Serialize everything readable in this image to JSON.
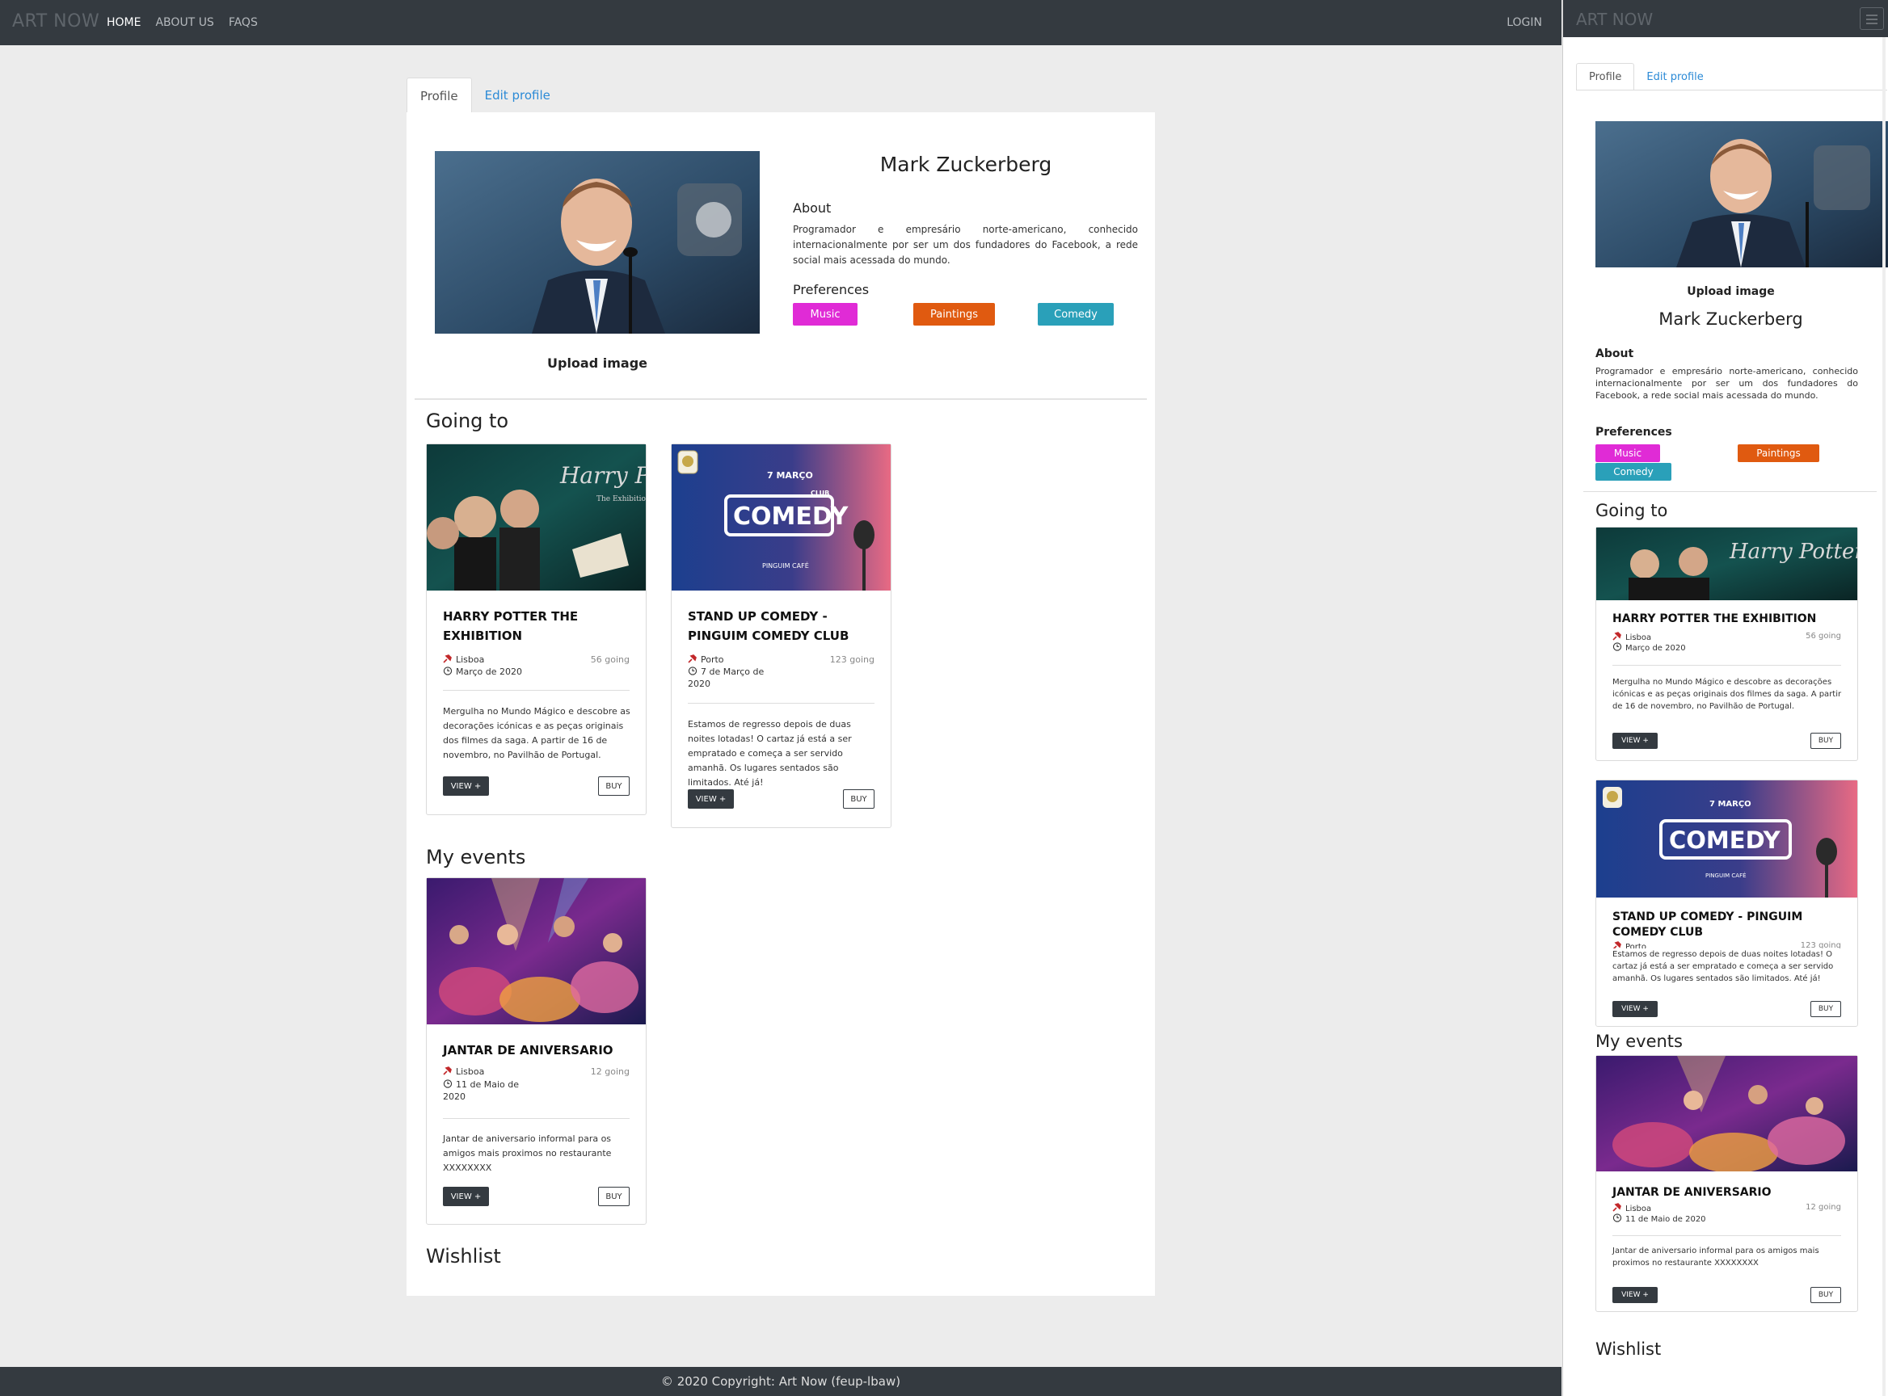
{
  "navbar": {
    "brand": "ART NOW",
    "links": [
      "HOME",
      "ABOUT US",
      "FAQS"
    ],
    "login": "LOGIN"
  },
  "tabs": [
    "Profile",
    "Edit profile"
  ],
  "profile": {
    "name": "Mark Zuckerberg",
    "upload": "Upload image",
    "about_heading": "About",
    "about_text": "Programador e empresário norte-americano, conhecido internacionalmente por ser um dos fundadores do Facebook, a rede social mais acessada do mundo.",
    "preferences_heading": "Preferences",
    "preferences": [
      {
        "label": "Music",
        "color": "#e02bd6"
      },
      {
        "label": "Paintings",
        "color": "#e05a10"
      },
      {
        "label": "Comedy",
        "color": "#2aa0b9"
      }
    ]
  },
  "sections": {
    "going": "Going to",
    "mine": "My events",
    "wishlist": "Wishlist"
  },
  "events": {
    "hp": {
      "title": "HARRY POTTER THE EXHIBITION",
      "location": "Lisboa",
      "date": "Março de 2020",
      "going": "56 going",
      "description": "Mergulha no Mundo Mágico e descobre as decorações icónicas e as peças originais dos filmes da saga. A partir de 16 de novembro, no Pavilhão de Portugal.",
      "image_text": "Harry Potter",
      "image_sub": "The Exhibition"
    },
    "comedy": {
      "title": "STAND UP COMEDY - PINGUIM COMEDY CLUB",
      "location": "Porto",
      "date": "7 de Março de 2020",
      "going": "123 going",
      "description": "Estamos de regresso depois de duas noites lotadas! O cartaz já está a ser empratado e começa a ser servido amanhã. Os lugares sentados são limitados. Até já!",
      "image_top": "7 MARÇO",
      "image_word": "COMEDY",
      "image_club": "CLUB",
      "image_bottom": "PINGUIM CAFÉ"
    },
    "party": {
      "title": "JANTAR DE ANIVERSARIO",
      "location": "Lisboa",
      "date": "11 de Maio de 2020",
      "going": "12 going",
      "description": "Jantar de aniversario informal para os amigos mais proximos no restaurante XXXXXXXX"
    }
  },
  "buttons": {
    "view": "VIEW +",
    "buy": "BUY"
  },
  "footer": "© 2020 Copyright: Art Now (feup-lbaw)",
  "colors": {
    "navbar": "#343a40",
    "link": "#2b8ad6"
  }
}
